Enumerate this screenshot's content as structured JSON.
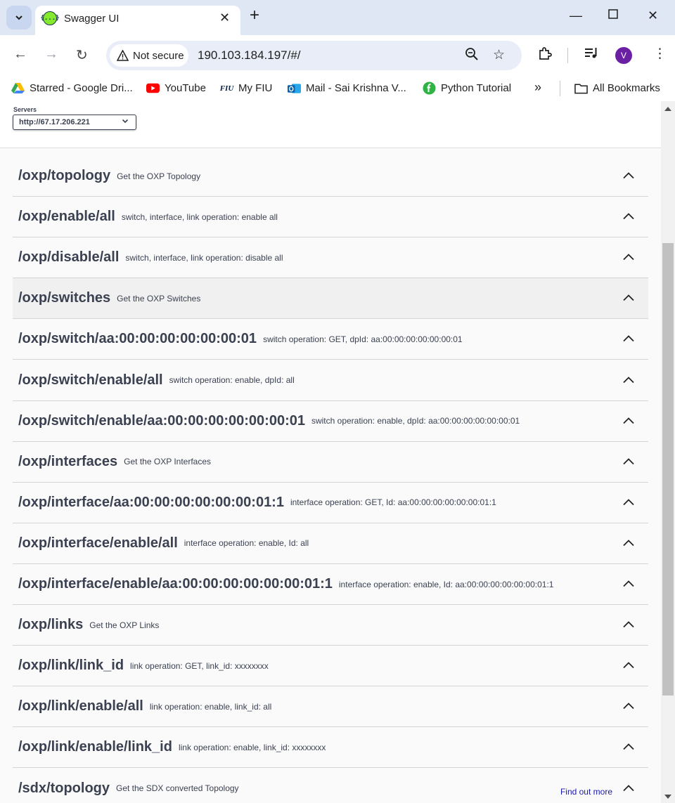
{
  "browser": {
    "tab_title": "Swagger UI",
    "favicon_text": "{...}",
    "security_chip": "Not secure",
    "url": "190.103.184.197/#/",
    "profile_initial": "V",
    "bookmarks": [
      {
        "label": "Starred - Google Dri...",
        "icon": "google-drive-icon"
      },
      {
        "label": "YouTube",
        "icon": "youtube-icon"
      },
      {
        "label": "My FIU",
        "icon": "fiu-icon",
        "icon_text": "FIU"
      },
      {
        "label": "Mail - Sai Krishna V...",
        "icon": "outlook-icon"
      },
      {
        "label": "Python Tutorial",
        "icon": "python-tutorial-icon"
      }
    ],
    "all_bookmarks": "All Bookmarks"
  },
  "servers": {
    "label": "Servers",
    "selected": "http://67.17.206.221"
  },
  "tags": [
    {
      "name": "/oxp/topology",
      "desc": "Get the OXP Topology"
    },
    {
      "name": "/oxp/enable/all",
      "desc": "switch, interface, link operation: enable all"
    },
    {
      "name": "/oxp/disable/all",
      "desc": "switch, interface, link operation: disable all"
    },
    {
      "name": "/oxp/switches",
      "desc": "Get the OXP Switches"
    },
    {
      "name": "/oxp/switch/aa:00:00:00:00:00:00:01",
      "desc": "switch operation: GET, dpId: aa:00:00:00:00:00:00:01"
    },
    {
      "name": "/oxp/switch/enable/all",
      "desc": "switch operation: enable, dpId: all"
    },
    {
      "name": "/oxp/switch/enable/aa:00:00:00:00:00:00:01",
      "desc": "switch operation: enable, dpId: aa:00:00:00:00:00:00:01"
    },
    {
      "name": "/oxp/interfaces",
      "desc": "Get the OXP Interfaces"
    },
    {
      "name": "/oxp/interface/aa:00:00:00:00:00:00:01:1",
      "desc": "interface operation: GET, Id: aa:00:00:00:00:00:00:01:1"
    },
    {
      "name": "/oxp/interface/enable/all",
      "desc": "interface operation: enable, Id: all"
    },
    {
      "name": "/oxp/interface/enable/aa:00:00:00:00:00:00:01:1",
      "desc": "interface operation: enable, Id: aa:00:00:00:00:00:00:01:1"
    },
    {
      "name": "/oxp/links",
      "desc": "Get the OXP Links"
    },
    {
      "name": "/oxp/link/link_id",
      "desc": "link operation: GET, link_id: xxxxxxxx"
    },
    {
      "name": "/oxp/link/enable/all",
      "desc": "link operation: enable, link_id: all"
    },
    {
      "name": "/oxp/link/enable/link_id",
      "desc": "link operation: enable, link_id: xxxxxxxx"
    },
    {
      "name": "/sdx/topology",
      "desc": "Get the SDX converted Topology",
      "external_link": "Find out more"
    }
  ]
}
